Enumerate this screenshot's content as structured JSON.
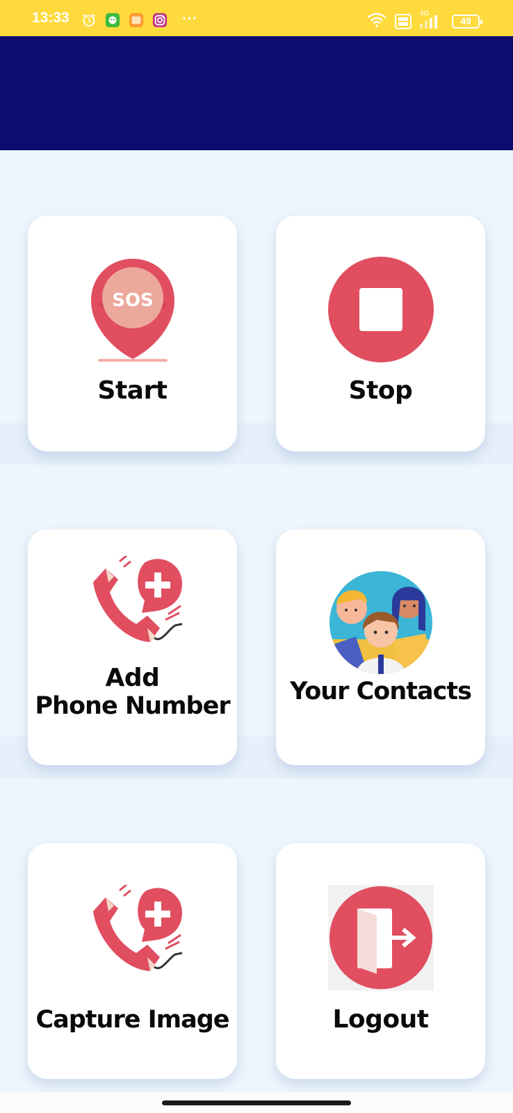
{
  "status_bar": {
    "time": "13:33",
    "battery": "49",
    "network": "4G",
    "overflow": "···",
    "left_icons": [
      "alarm-icon",
      "app-notification-icon",
      "gallery-icon",
      "instagram-icon"
    ],
    "right_icons": [
      "wifi-icon",
      "volte-icon",
      "signal-icon",
      "battery-icon"
    ]
  },
  "colors": {
    "status_bar": "#ffda3d",
    "header": "#0b0c6e",
    "background": "#eef6fd",
    "accent_red": "#e04e60",
    "card": "#ffffff"
  },
  "cards": [
    {
      "id": "start",
      "label": "Start",
      "icon": "sos-location-pin-icon"
    },
    {
      "id": "stop",
      "label": "Stop",
      "icon": "stop-icon"
    },
    {
      "id": "add-phone",
      "label_line1": "Add",
      "label_line2": "Phone Number",
      "icon": "phone-plus-icon"
    },
    {
      "id": "contacts",
      "label": "Your Contacts",
      "icon": "contacts-group-icon"
    },
    {
      "id": "capture",
      "label": "Capture Image",
      "icon": "phone-plus-icon"
    },
    {
      "id": "logout",
      "label": "Logout",
      "icon": "logout-door-icon"
    }
  ],
  "sos_text": "SOS"
}
